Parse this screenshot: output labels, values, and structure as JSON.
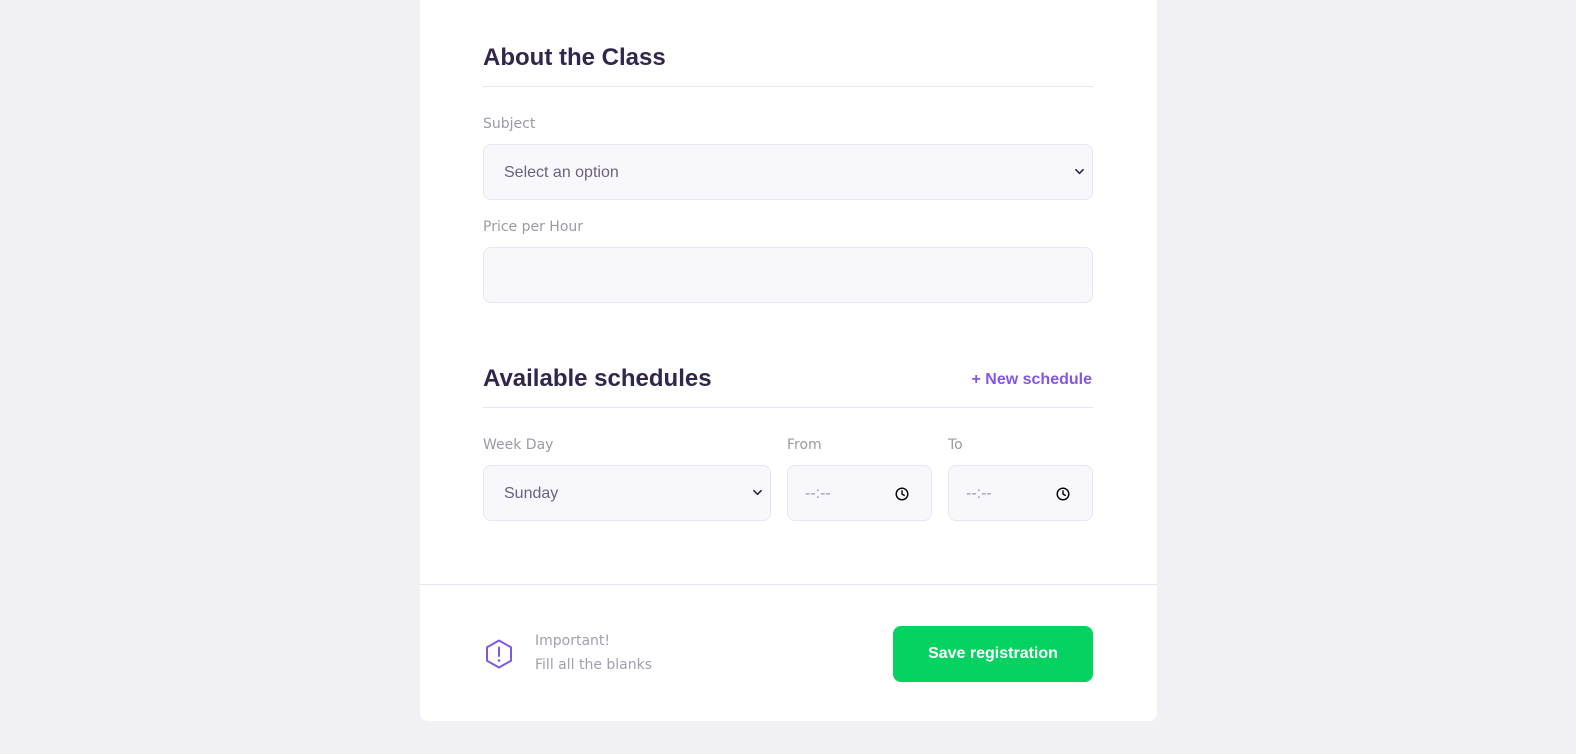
{
  "about": {
    "title": "About the Class",
    "subject_label": "Subject",
    "subject_value": "Select an option",
    "price_label": "Price per Hour",
    "price_value": ""
  },
  "schedules": {
    "title": "Available schedules",
    "new_schedule_label": "+ New schedule",
    "week_day_label": "Week Day",
    "week_day_value": "Sunday",
    "from_label": "From",
    "from_value": "--:--",
    "to_label": "To",
    "to_value": "--:--"
  },
  "footer": {
    "important_label": "Important!",
    "important_text": "Fill all the blanks",
    "save_label": "Save registration"
  },
  "colors": {
    "accent": "#8257e5",
    "save": "#04d361",
    "title": "#32264d",
    "background": "#f0f0f5"
  },
  "icons": {
    "warning": "warning-hexagon-icon",
    "chevron": "chevron-down-icon",
    "clock": "clock-icon"
  }
}
